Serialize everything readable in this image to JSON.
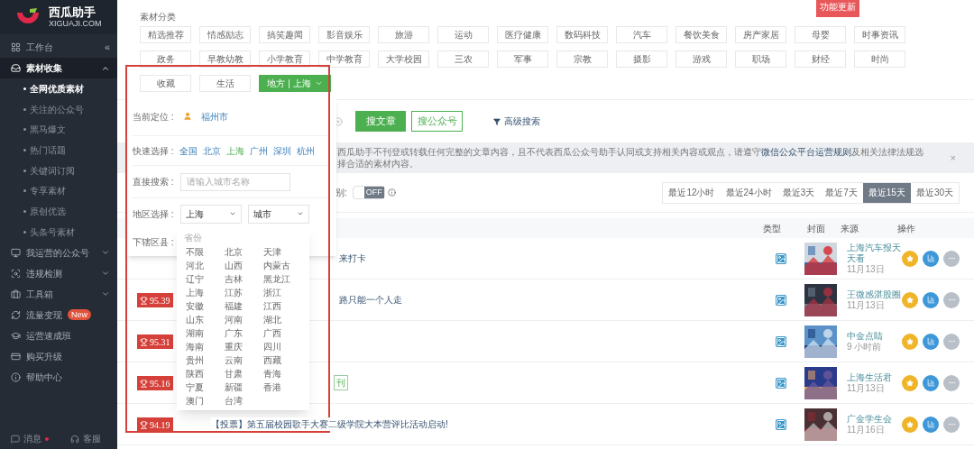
{
  "brand": {
    "name": "西瓜助手",
    "domain": "XIGUAJI.COM"
  },
  "sidebar": {
    "items": [
      {
        "label": "工作台",
        "kind": "link",
        "selected": false,
        "collapse": "«"
      },
      {
        "label": "素材收集",
        "kind": "group",
        "expanded": true,
        "selected": true,
        "children": [
          {
            "label": "全网优质素材",
            "selected": true
          },
          {
            "label": "关注的公众号",
            "selected": false
          },
          {
            "label": "黑马爆文",
            "selected": false
          },
          {
            "label": "热门话题",
            "selected": false
          },
          {
            "label": "关键词订阅",
            "selected": false
          },
          {
            "label": "专享素材",
            "selected": false
          },
          {
            "label": "原创优选",
            "selected": false
          },
          {
            "label": "头条号素材",
            "selected": false
          }
        ]
      },
      {
        "label": "我运营的公众号",
        "kind": "group",
        "expanded": false,
        "selected": false
      },
      {
        "label": "违规检测",
        "kind": "group",
        "expanded": false,
        "selected": false
      },
      {
        "label": "工具箱",
        "kind": "group",
        "expanded": false,
        "selected": false
      },
      {
        "label": "流量变现",
        "kind": "link",
        "selected": false,
        "badge": "New"
      },
      {
        "label": "运营速成班",
        "kind": "link",
        "selected": false
      },
      {
        "label": "购买升级",
        "kind": "link",
        "selected": false
      },
      {
        "label": "帮助中心",
        "kind": "link",
        "selected": false
      }
    ],
    "footer": [
      {
        "label": "消息",
        "unread": true
      },
      {
        "label": "客服",
        "unread": false
      }
    ]
  },
  "categories": {
    "title": "素材分类",
    "ribbon": "功能更新",
    "rows": [
      [
        {
          "label": "精选推荐",
          "selected": false
        },
        {
          "label": "情感励志",
          "selected": false
        },
        {
          "label": "搞笑趣闻",
          "selected": false
        },
        {
          "label": "影音娱乐",
          "selected": false
        },
        {
          "label": "旅游",
          "selected": false
        },
        {
          "label": "运动",
          "selected": false
        },
        {
          "label": "医疗健康",
          "selected": false
        },
        {
          "label": "数码科技",
          "selected": false
        },
        {
          "label": "汽车",
          "selected": false
        },
        {
          "label": "餐饮美食",
          "selected": false
        },
        {
          "label": "房产家居",
          "selected": false
        },
        {
          "label": "母婴",
          "selected": false
        },
        {
          "label": "时事资讯",
          "selected": false
        }
      ],
      [
        {
          "label": "政务",
          "selected": false
        },
        {
          "label": "早教幼教",
          "selected": false
        },
        {
          "label": "小学教育",
          "selected": false
        },
        {
          "label": "中学教育",
          "selected": false
        },
        {
          "label": "大学校园",
          "selected": false
        },
        {
          "label": "三农",
          "selected": false
        },
        {
          "label": "军事",
          "selected": false
        },
        {
          "label": "宗教",
          "selected": false
        },
        {
          "label": "摄影",
          "selected": false
        },
        {
          "label": "游戏",
          "selected": false
        },
        {
          "label": "职场",
          "selected": false
        },
        {
          "label": "财经",
          "selected": false
        },
        {
          "label": "时尚",
          "selected": false
        }
      ],
      [
        {
          "label": "收藏",
          "selected": false
        },
        {
          "label": "生活",
          "selected": false
        },
        {
          "label": "地方 | 上海",
          "selected": true
        }
      ]
    ]
  },
  "search": {
    "article_button": "搜文章",
    "account_button": "搜公众号",
    "advanced": "高级搜索"
  },
  "notice": {
    "before": "西瓜助手不刊登或转载任何完整的文章内容，且不代表西瓜公众号助手认同或支持相关内容或观点，请遵守",
    "link": "微信公众平台运营规则",
    "after": "及相关法律法规选择合适的素材内容。",
    "close": "×"
  },
  "filter": {
    "label": "别:",
    "toggle": {
      "on": false,
      "text": "OFF"
    },
    "ranges": [
      {
        "label": "最近12小时",
        "selected": false
      },
      {
        "label": "最近24小时",
        "selected": false
      },
      {
        "label": "最近3天",
        "selected": false
      },
      {
        "label": "最近7天",
        "selected": false
      },
      {
        "label": "最近15天",
        "selected": true
      },
      {
        "label": "最近30天",
        "selected": false
      }
    ]
  },
  "table": {
    "columns": [
      "类型",
      "封面",
      "来源",
      "操作"
    ],
    "rows": [
      {
        "title": "来打卡",
        "source": "上海汽车报天天看",
        "date": "11月13日"
      },
      {
        "score": "95.39",
        "title": "路只能一个人走",
        "source": "王微感湛股圈",
        "date": "11月13日"
      },
      {
        "score": "95.31",
        "source": "中金点睛",
        "date": "9 小时前"
      },
      {
        "score": "95.16",
        "tag": "刊",
        "source": "上海生活君",
        "date": "11月13日"
      },
      {
        "score": "94.19",
        "title": "【投票】第五届校园歌手大赛二级学院大本营评比活动启动!",
        "source": "广金学生会",
        "date": "11月16日"
      }
    ]
  },
  "location_popup": {
    "current_label": "当前定位 :",
    "current_city": "福州市",
    "quick_label": "快速选择 :",
    "quick": [
      {
        "label": "全国",
        "selected": false
      },
      {
        "label": "北京",
        "selected": false
      },
      {
        "label": "上海",
        "selected": true
      },
      {
        "label": "广州",
        "selected": false
      },
      {
        "label": "深圳",
        "selected": false
      },
      {
        "label": "杭州",
        "selected": false
      }
    ],
    "search_label": "直接搜索 :",
    "search_placeholder": "请输入城市名称",
    "region_label": "地区选择 :",
    "province": "上海",
    "city": "城市",
    "district_label": "下辖区县 :",
    "province_list": {
      "header": "省份",
      "items": [
        "不限",
        "北京",
        "天津",
        "河北",
        "山西",
        "内蒙古",
        "辽宁",
        "吉林",
        "黑龙江",
        "上海",
        "江苏",
        "浙江",
        "安徽",
        "福建",
        "江西",
        "山东",
        "河南",
        "湖北",
        "湖南",
        "广东",
        "广西",
        "海南",
        "重庆",
        "四川",
        "贵州",
        "云南",
        "西藏",
        "陕西",
        "甘肃",
        "青海",
        "宁夏",
        "新疆",
        "香港",
        "澳门",
        "台湾"
      ]
    }
  }
}
